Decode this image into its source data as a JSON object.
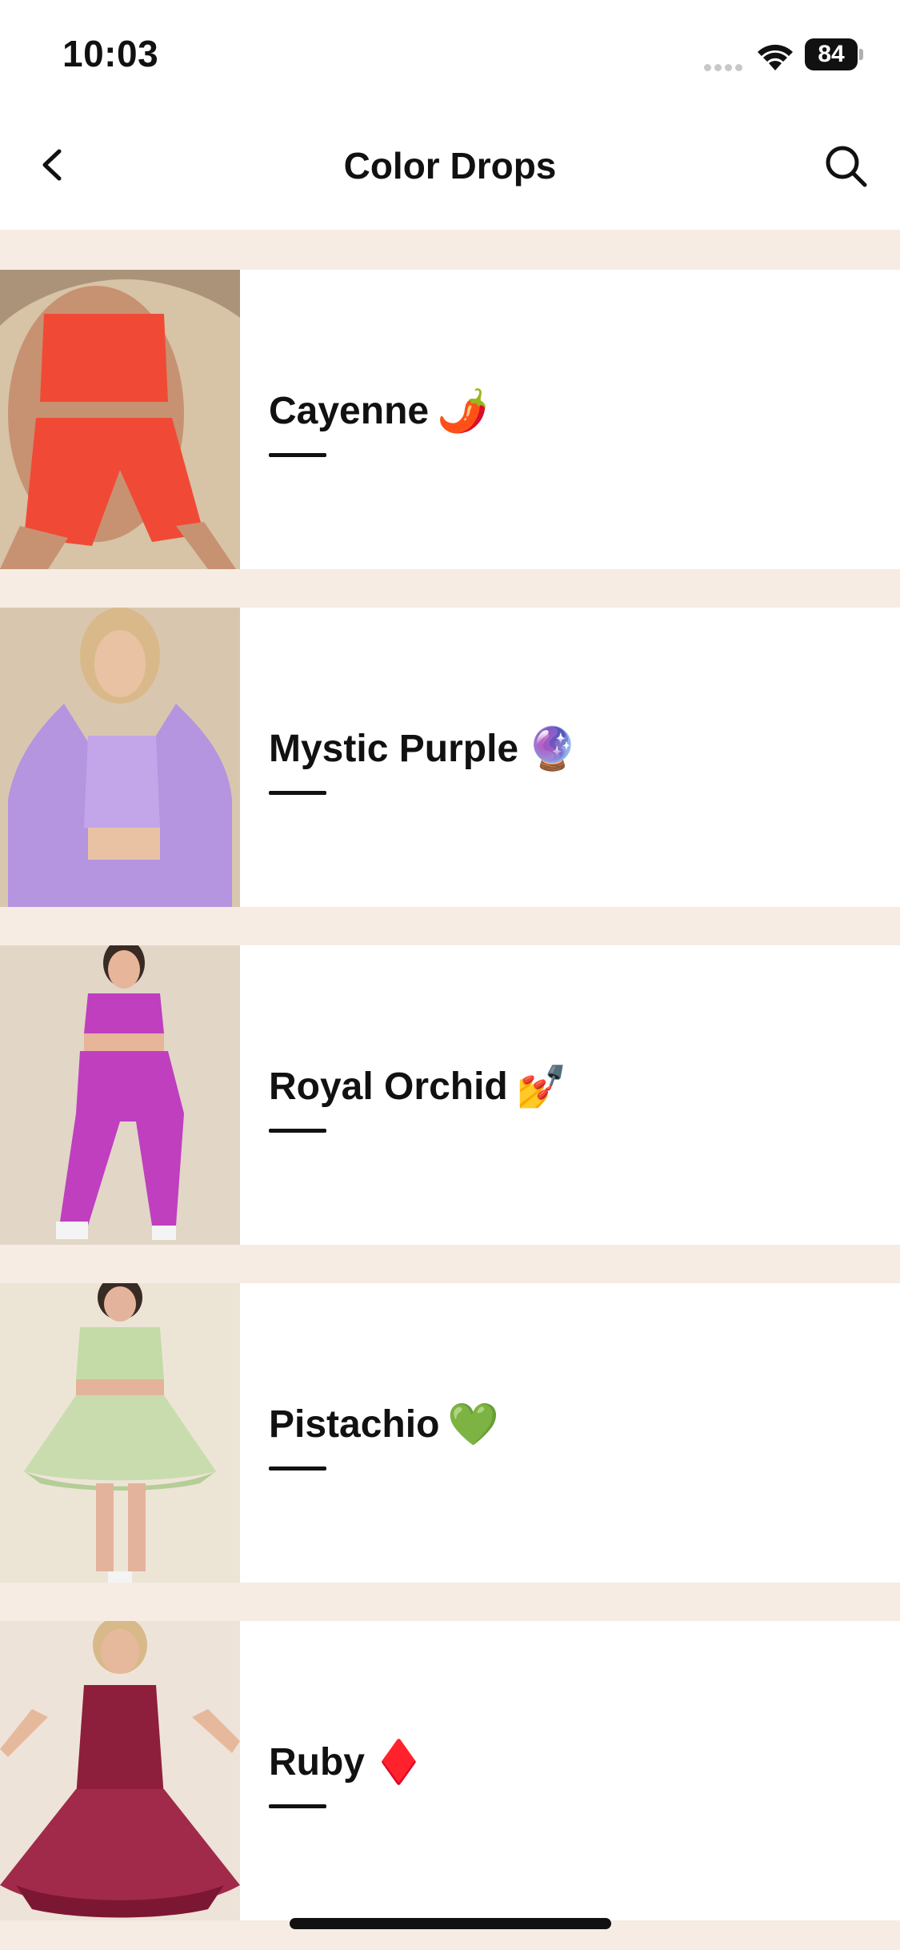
{
  "status_bar": {
    "time": "10:03",
    "battery": "84"
  },
  "nav": {
    "title": "Color Drops",
    "back_icon": "chevron-left-icon",
    "search_icon": "search-icon"
  },
  "items": [
    {
      "label": "Cayenne",
      "emoji": "🌶️",
      "accent": "#f04a36",
      "bg": "#d7c3a6"
    },
    {
      "label": "Mystic Purple",
      "emoji": "🔮",
      "accent": "#b594e0",
      "bg": "#d8c7ae"
    },
    {
      "label": "Royal Orchid",
      "emoji": "💅",
      "accent": "#bf3fbf",
      "bg": "#e2d6c7"
    },
    {
      "label": "Pistachio",
      "emoji": "💚",
      "accent": "#c4dba8",
      "bg": "#ece5d6"
    },
    {
      "label": "Ruby",
      "emoji": "♦️",
      "accent": "#8e1f3c",
      "bg": "#eee3d9"
    }
  ],
  "colors": {
    "page_bg": "#f6ece3",
    "card_bg": "#ffffff",
    "text": "#111111"
  }
}
